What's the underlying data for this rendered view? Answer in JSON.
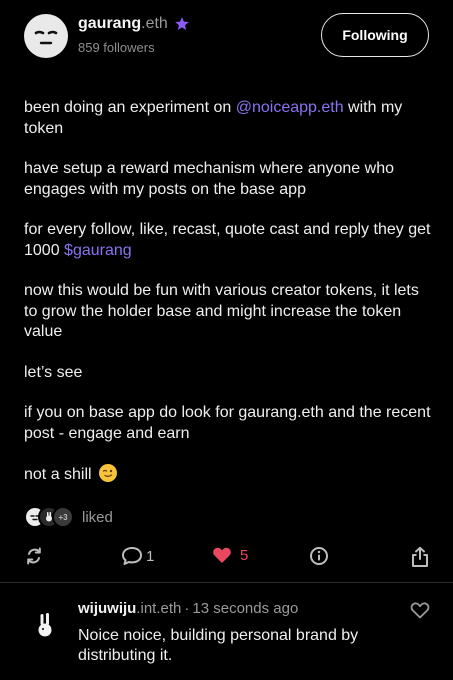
{
  "colors": {
    "accent": "#8a72f0",
    "like_red": "#e84860",
    "background": "#000000"
  },
  "author": {
    "name": "gaurang",
    "domain": ".eth",
    "badge_icon": "star-badge-icon",
    "followers": "859 followers",
    "follow_button": "Following"
  },
  "post": {
    "p1_before": "been doing an experiment on ",
    "p1_link": "@noiceapp.eth",
    "p1_after": " with my token",
    "p2": "have setup a reward mechanism where anyone who engages with my posts on the base app",
    "p3_before": "for every follow, like, recast, quote cast and reply they get 1000 ",
    "p3_link": "$gaurang",
    "p4": "now this would be fun with various creator tokens, it lets to grow the holder base and might increase the token value",
    "p5": "let’s see",
    "p6": "if you on base app do look for gaurang.eth and the recent post - engage and earn",
    "p7": "not a shill",
    "p7_emoji": "wink-emoji-icon"
  },
  "liked": {
    "extra": "+3",
    "label": "liked"
  },
  "actions": {
    "recast_icon": "recast-icon",
    "reply_count": "1",
    "like_count": "5",
    "info_icon": "info-icon",
    "share_icon": "share-icon"
  },
  "reply": {
    "name": "wijuwiju",
    "domain": ".int.eth",
    "separator": "·",
    "time": "13 seconds ago",
    "text": "Noice noice, building personal brand by distributing it."
  }
}
